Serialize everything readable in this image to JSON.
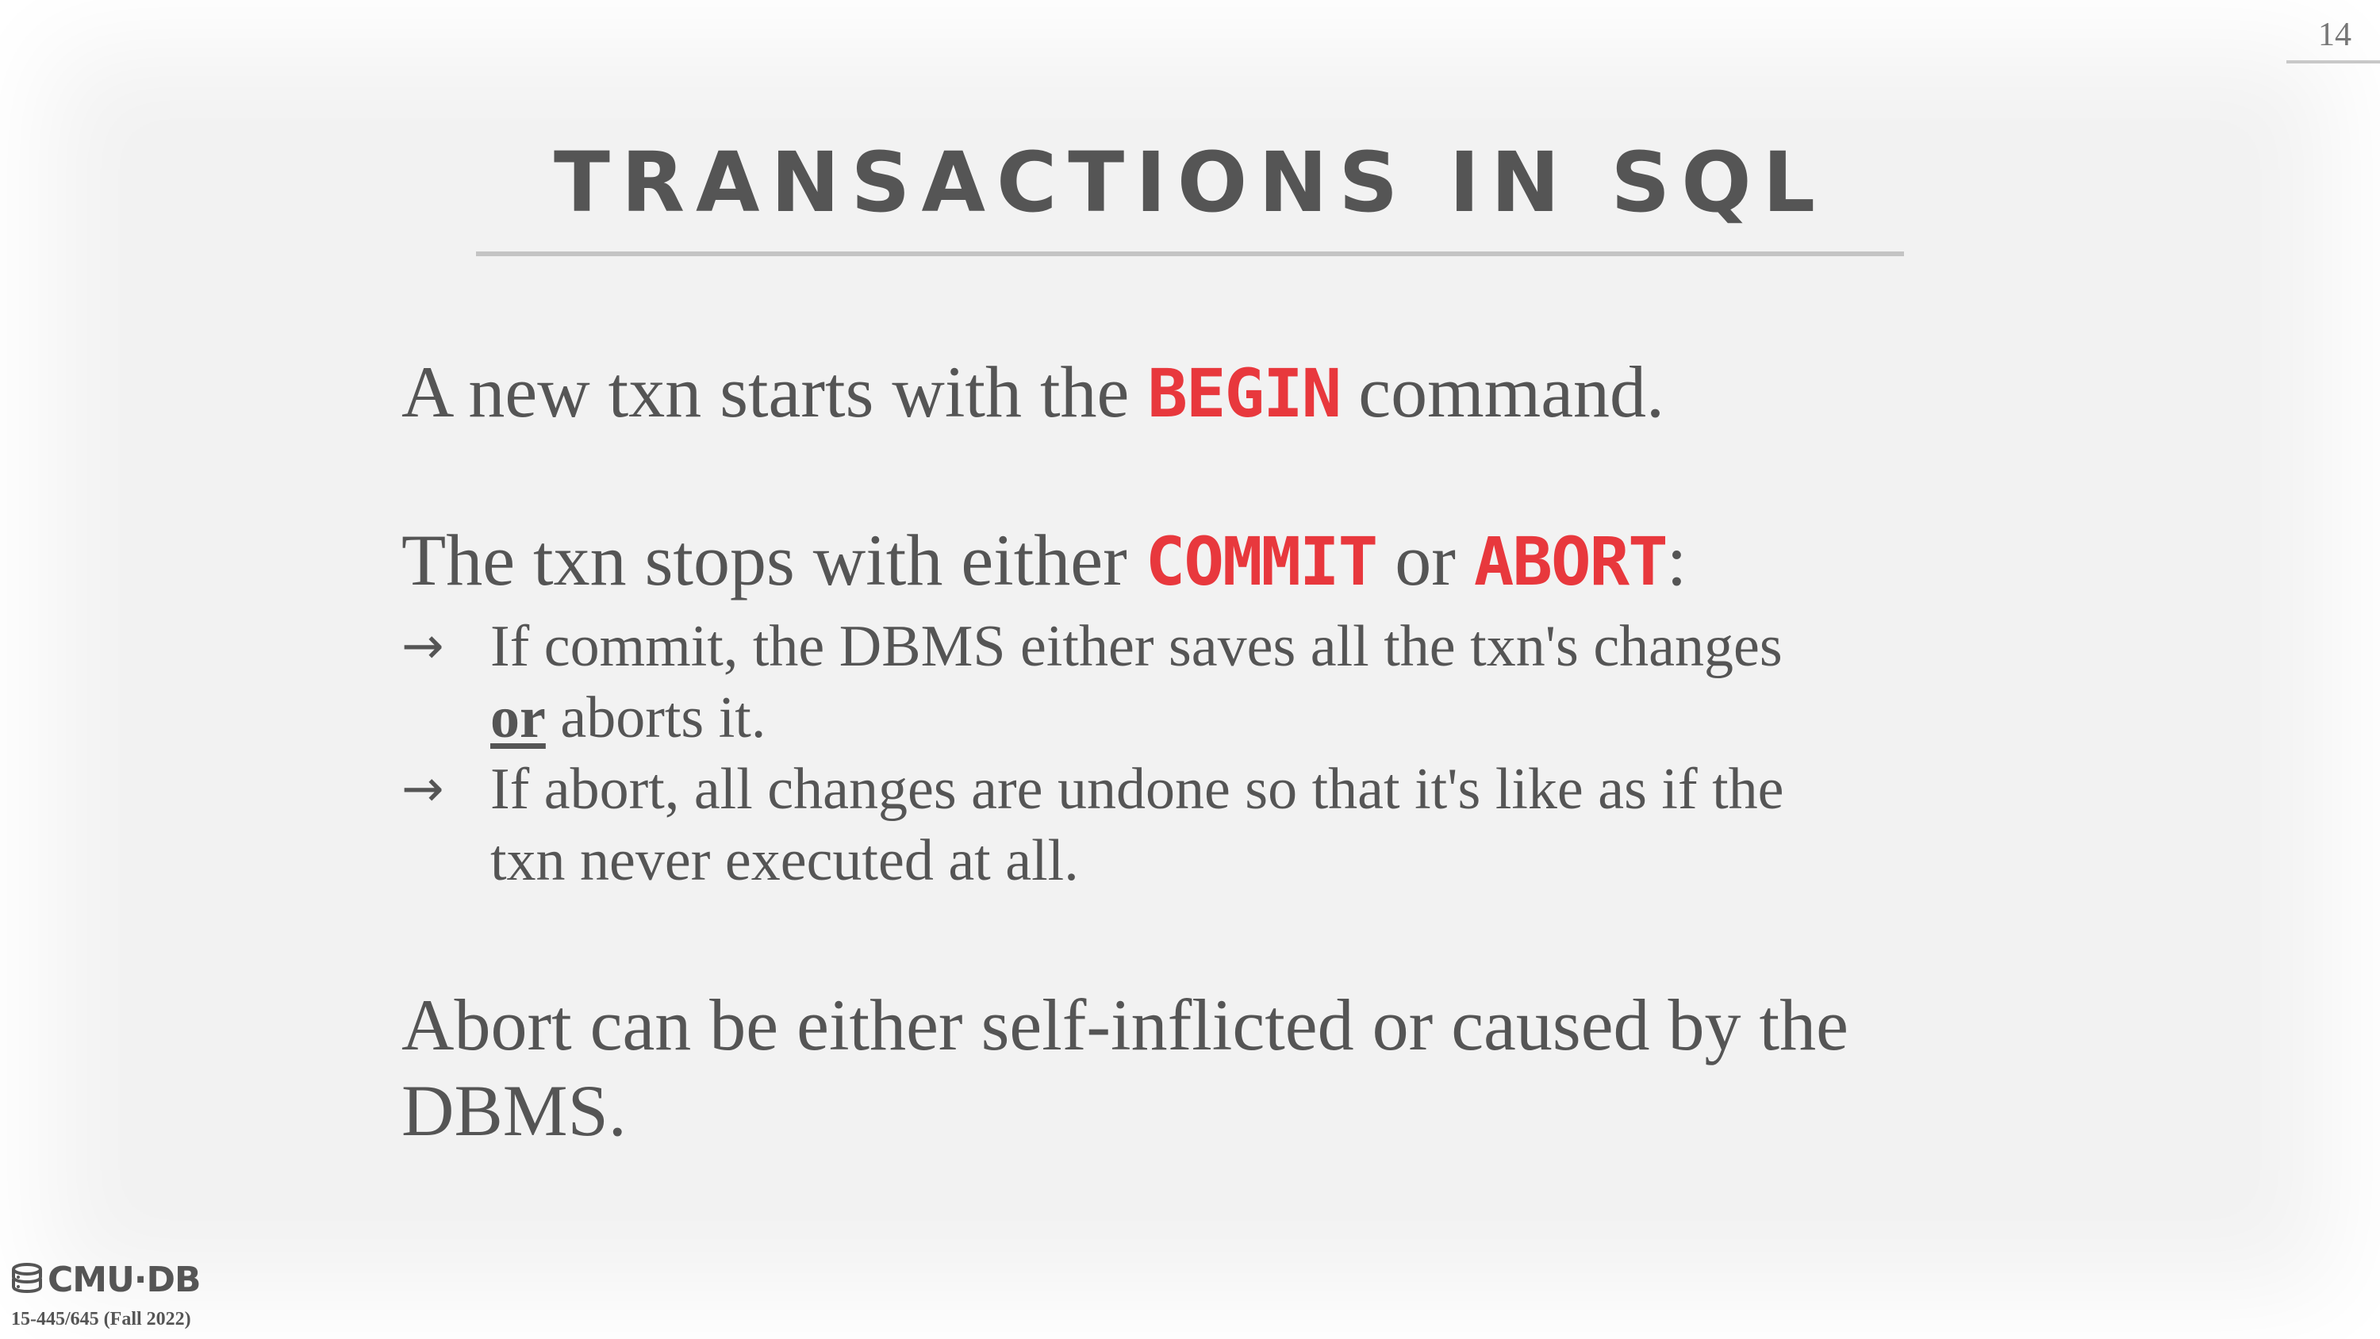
{
  "slide": {
    "page_number": "14",
    "title": "TRANSACTIONS IN SQL"
  },
  "body": {
    "p1": {
      "before": "A new txn starts with the ",
      "keyword": "BEGIN",
      "after": " command."
    },
    "p2": {
      "before": "The txn stops with either ",
      "keyword1": "COMMIT",
      "middle": " or ",
      "keyword2": "ABORT",
      "after": ":"
    },
    "bullets": [
      {
        "arrow": "→",
        "line1": "If commit, the DBMS either saves all the txn's changes",
        "line2_emph": "or",
        "line2_rest": " aborts it."
      },
      {
        "arrow": "→",
        "line1": "If abort, all changes are undone so that it's like as if the",
        "line2": "txn never executed at all."
      }
    ],
    "p3": {
      "line1": "Abort can be either self-inflicted or caused by the",
      "line2": "DBMS."
    }
  },
  "footer": {
    "logo_text": "CMU·DB",
    "logo_icon": "database-icon",
    "course": "15-445/645 (Fall 2022)"
  },
  "colors": {
    "keyword": "#e8383d",
    "text": "#555555",
    "background": "#f2f2f2"
  }
}
